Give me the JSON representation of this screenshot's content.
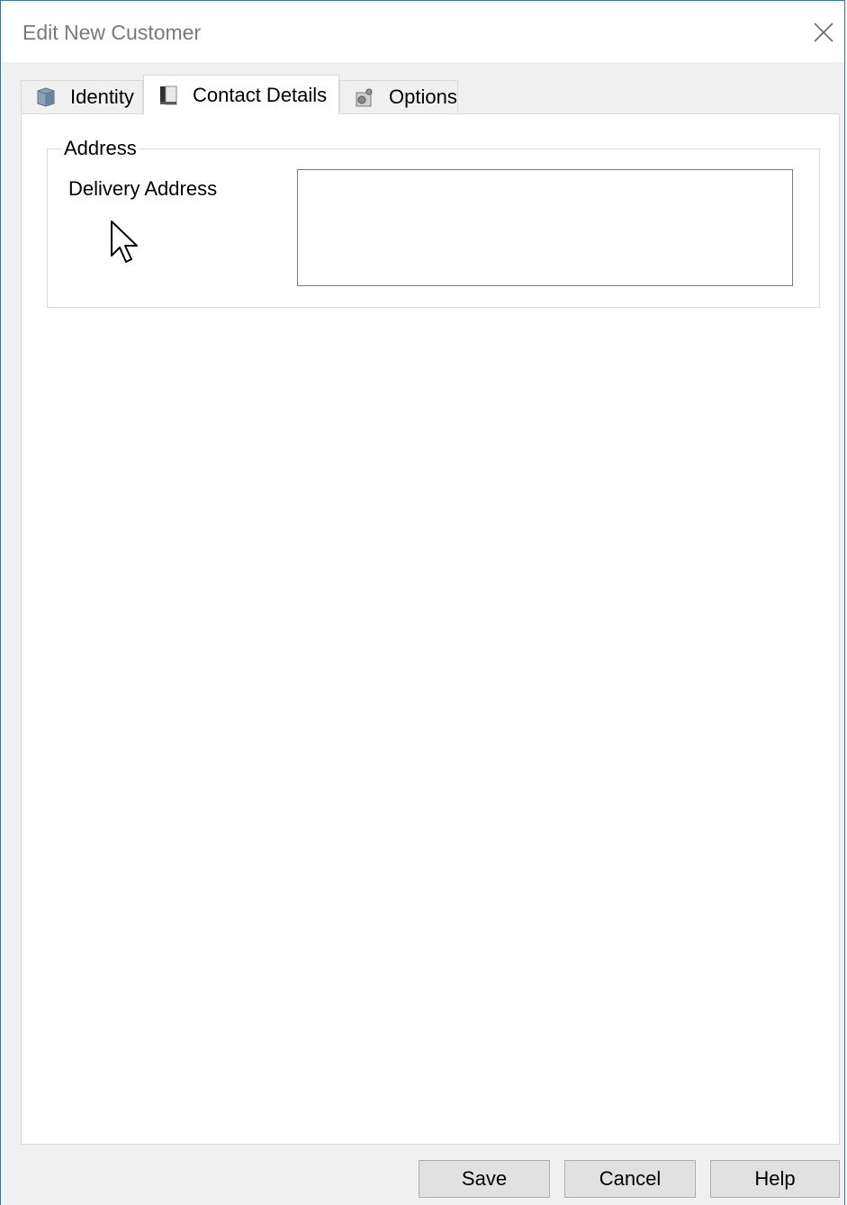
{
  "window": {
    "title": "Edit New Customer",
    "close_icon": "close-icon"
  },
  "tabs": [
    {
      "label": "Identity",
      "icon": "identity-icon",
      "active": false
    },
    {
      "label": "Contact Details",
      "icon": "contact-book-icon",
      "active": true
    },
    {
      "label": "Options",
      "icon": "options-icon",
      "active": false
    }
  ],
  "address_group": {
    "legend": "Address",
    "delivery_label": "Delivery Address",
    "delivery_value": ""
  },
  "buttons": {
    "save": "Save",
    "cancel": "Cancel",
    "help": "Help"
  },
  "colors": {
    "window_border": "#2b7bb0",
    "panel_bg": "#ffffff",
    "chrome_bg": "#f0f0f0",
    "button_bg": "#e1e1e1"
  }
}
